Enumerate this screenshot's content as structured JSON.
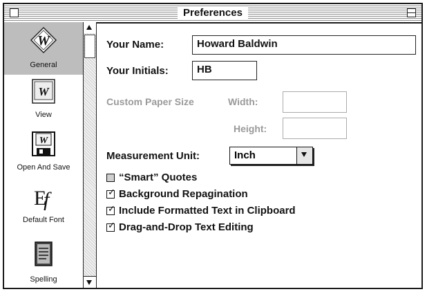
{
  "window": {
    "title": "Preferences"
  },
  "sidebar": {
    "items": [
      {
        "label": "General",
        "icon": "word-w-logo-icon",
        "selected": true
      },
      {
        "label": "View",
        "icon": "view-document-icon",
        "selected": false
      },
      {
        "label": "Open And Save",
        "icon": "floppy-disk-icon",
        "selected": false
      },
      {
        "label": "Default Font",
        "icon": "font-ef-icon",
        "selected": false
      },
      {
        "label": "Spelling",
        "icon": "spelling-book-icon",
        "selected": false
      }
    ]
  },
  "general": {
    "name_label": "Your Name:",
    "name_value": "Howard Baldwin",
    "initials_label": "Your Initials:",
    "initials_value": "HB",
    "custom_paper_label": "Custom Paper Size",
    "width_label": "Width:",
    "width_value": "",
    "height_label": "Height:",
    "height_value": "",
    "measurement_label": "Measurement Unit:",
    "measurement_value": "Inch",
    "options": [
      {
        "label": "“Smart” Quotes",
        "checked": false
      },
      {
        "label": "Background Repagination",
        "checked": true
      },
      {
        "label": "Include Formatted Text in Clipboard",
        "checked": true
      },
      {
        "label": "Drag-and-Drop Text Editing",
        "checked": true
      }
    ]
  },
  "colors": {
    "selected_item": "#bdbdbd",
    "disabled_text": "#9a9a9a"
  }
}
